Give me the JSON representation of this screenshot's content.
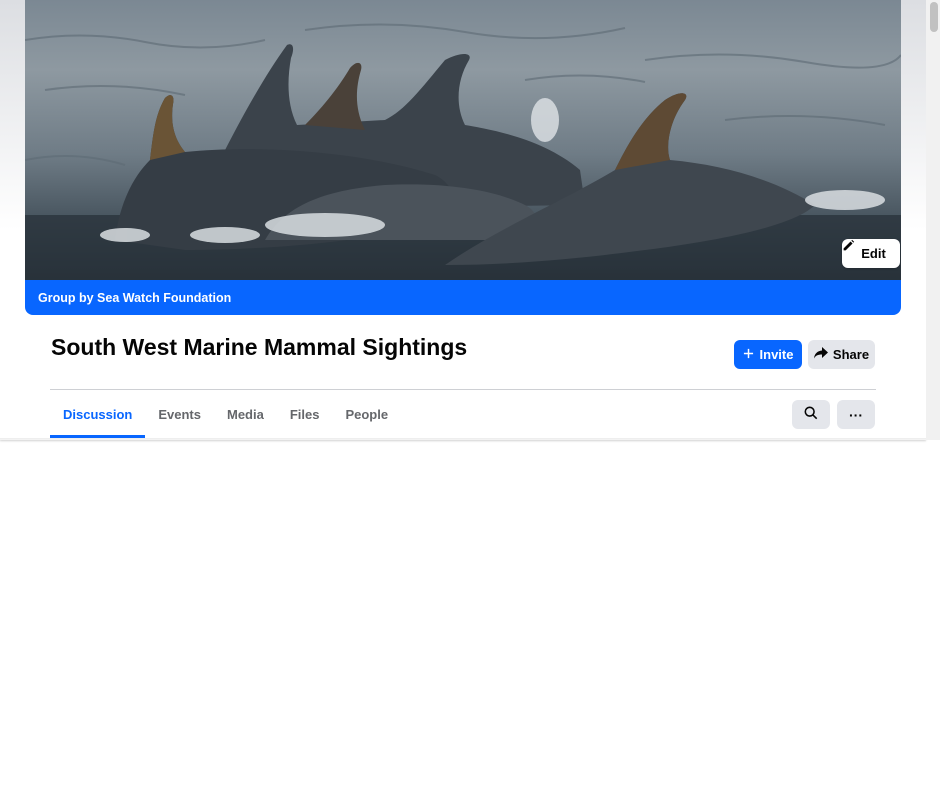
{
  "cover": {
    "image_alt": "Dolphins swimming at the sea surface",
    "edit_label": "Edit",
    "edit_icon": "pencil-icon"
  },
  "group": {
    "owner_line": "Group by Sea Watch Foundation",
    "title": "South West Marine Mammal Sightings"
  },
  "actions": {
    "invite_label": "Invite",
    "invite_icon": "plus-icon",
    "share_label": "Share",
    "share_icon": "share-arrow-icon"
  },
  "tabs": [
    {
      "label": "Discussion",
      "active": true
    },
    {
      "label": "Events",
      "active": false
    },
    {
      "label": "Media",
      "active": false
    },
    {
      "label": "Files",
      "active": false
    },
    {
      "label": "People",
      "active": false
    }
  ],
  "toolbar": {
    "search_icon": "search-icon",
    "more_label": "···"
  },
  "colors": {
    "accent": "#0866ff",
    "secondary_button": "#e4e6eb",
    "muted_text": "#65676b"
  }
}
